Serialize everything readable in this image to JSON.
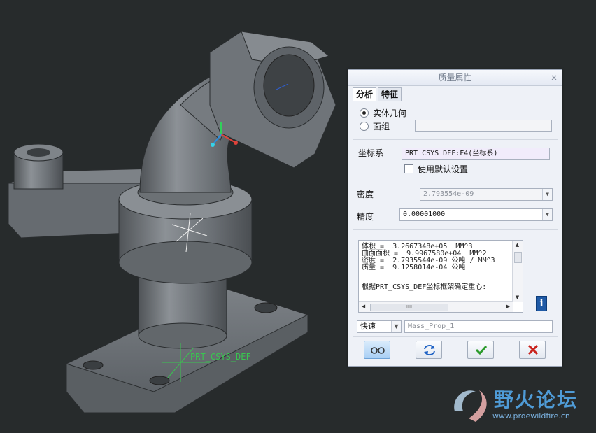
{
  "dialog": {
    "title": "质量属性",
    "close": "×",
    "tabs": [
      "分析",
      "特征"
    ],
    "radio_solid": "实体几何",
    "radio_quilt": "面组",
    "quilt_value": "",
    "csys_label": "坐标系",
    "csys_value": "PRT_CSYS_DEF:F4(坐标系)",
    "use_default_label": "使用默认设置",
    "use_default_checked": false,
    "density_label": "密度",
    "density_value": "2.793554e-09",
    "accuracy_label": "精度",
    "accuracy_value": "0.00001000",
    "results": [
      "体积 =  3.2667348e+05  MM^3",
      "曲面面积 =  9.9967580e+04  MM^2",
      "密度 =  2.7935544e-09 公吨 / MM^3",
      "质量 =  9.1258014e-04 公吨",
      "",
      "根据PRT_CSYS_DEF坐标框架确定重心:"
    ],
    "scroll_grip": "IIII",
    "info_icon": "i",
    "mode_value": "快速",
    "feature_name": "Mass_Prop_1",
    "buttons": [
      "preview-glasses-icon",
      "repeat-icon",
      "ok-check-icon",
      "cancel-x-icon"
    ]
  },
  "viewport": {
    "csys_label": "PRT_CSYS_DEF",
    "background": "#272b2c",
    "model_color": "#6f7478"
  },
  "watermark": {
    "title": "野火论坛",
    "url": "www.proewildfire.cn"
  }
}
